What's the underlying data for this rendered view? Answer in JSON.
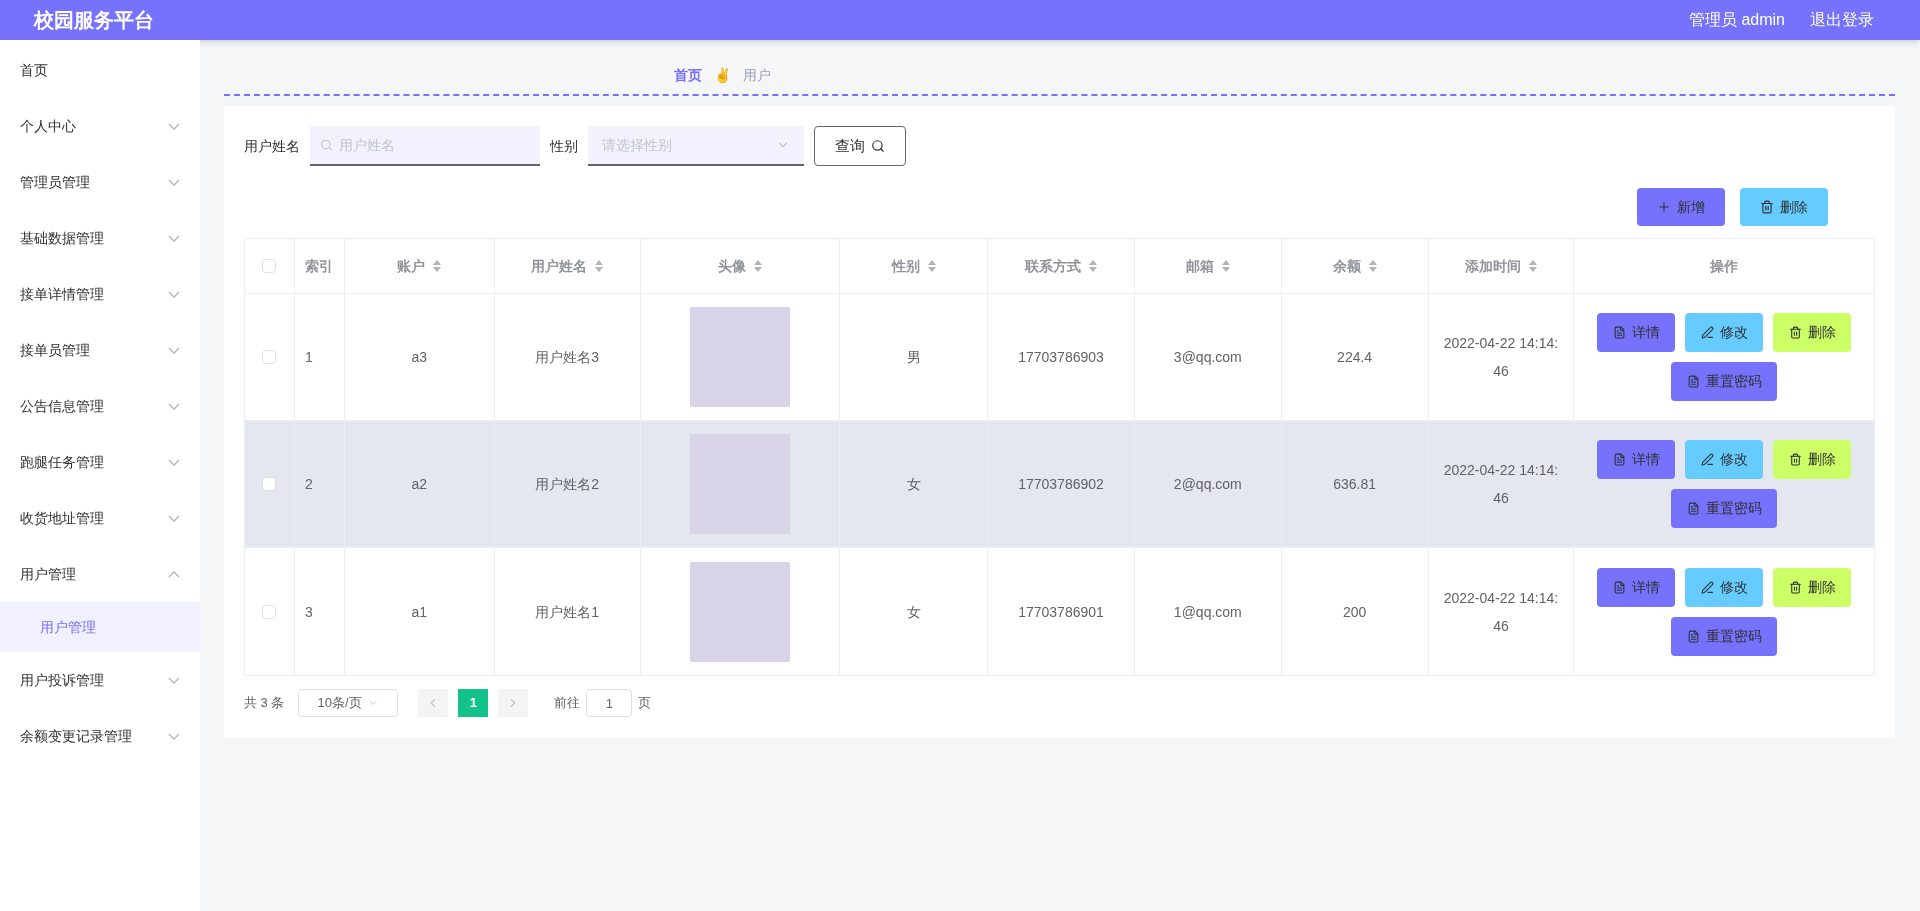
{
  "header": {
    "title": "校园服务平台",
    "user": "管理员 admin",
    "logout": "退出登录"
  },
  "sidebar": {
    "items": [
      {
        "label": "首页",
        "kind": "link"
      },
      {
        "label": "个人中心",
        "kind": "menu",
        "expanded": false
      },
      {
        "label": "管理员管理",
        "kind": "menu",
        "expanded": false
      },
      {
        "label": "基础数据管理",
        "kind": "menu",
        "expanded": false
      },
      {
        "label": "接单详情管理",
        "kind": "menu",
        "expanded": false
      },
      {
        "label": "接单员管理",
        "kind": "menu",
        "expanded": false
      },
      {
        "label": "公告信息管理",
        "kind": "menu",
        "expanded": false
      },
      {
        "label": "跑腿任务管理",
        "kind": "menu",
        "expanded": false
      },
      {
        "label": "收货地址管理",
        "kind": "menu",
        "expanded": false
      },
      {
        "label": "用户管理",
        "kind": "menu",
        "expanded": true,
        "children": [
          {
            "label": "用户管理",
            "selected": true
          }
        ]
      },
      {
        "label": "用户投诉管理",
        "kind": "menu",
        "expanded": false
      },
      {
        "label": "余额变更记录管理",
        "kind": "menu",
        "expanded": false
      }
    ]
  },
  "breadcrumb": {
    "items": [
      {
        "label": "首页",
        "selected": true
      },
      {
        "label": "用户",
        "selected": false
      }
    ],
    "separator": "✌"
  },
  "search": {
    "name_label": "用户姓名",
    "name_placeholder": "用户姓名",
    "gender_label": "性别",
    "gender_placeholder": "请选择性别",
    "query": "查询"
  },
  "toolbar": {
    "add": "新增",
    "delete": "删除"
  },
  "table": {
    "columns": [
      {
        "label": "索引",
        "sortable": false
      },
      {
        "label": "账户",
        "sortable": true
      },
      {
        "label": "用户姓名",
        "sortable": true
      },
      {
        "label": "头像",
        "sortable": true
      },
      {
        "label": "性别",
        "sortable": true
      },
      {
        "label": "联系方式",
        "sortable": true
      },
      {
        "label": "邮箱",
        "sortable": true
      },
      {
        "label": "余额",
        "sortable": true
      },
      {
        "label": "添加时间",
        "sortable": true
      },
      {
        "label": "操作",
        "sortable": false
      }
    ],
    "header_checked": false,
    "rows": [
      {
        "checked": false,
        "hovered": false,
        "cells": [
          "1",
          "a3",
          "用户姓名3",
          "",
          "男",
          "17703786903",
          "3@qq.com",
          "224.4",
          "2022-04-22 14:14:46"
        ],
        "actions": [
          "详情",
          "修改",
          "删除",
          "重置密码"
        ]
      },
      {
        "checked": false,
        "hovered": true,
        "cells": [
          "2",
          "a2",
          "用户姓名2",
          "",
          "女",
          "17703786902",
          "2@qq.com",
          "636.81",
          "2022-04-22 14:14:46"
        ],
        "actions": [
          "详情",
          "修改",
          "删除",
          "重置密码"
        ]
      },
      {
        "checked": false,
        "hovered": false,
        "cells": [
          "3",
          "a1",
          "用户姓名1",
          "",
          "女",
          "17703786901",
          "1@qq.com",
          "200",
          "2022-04-22 14:14:46"
        ],
        "actions": [
          "详情",
          "修改",
          "删除",
          "重置密码"
        ]
      }
    ]
  },
  "pagination": {
    "total": "共 3 条",
    "page_size": "10条/页",
    "pages": [
      {
        "label": "1",
        "selected": true
      }
    ],
    "jump_label": "前往",
    "jump_value": "1",
    "jump_suffix": "页"
  }
}
